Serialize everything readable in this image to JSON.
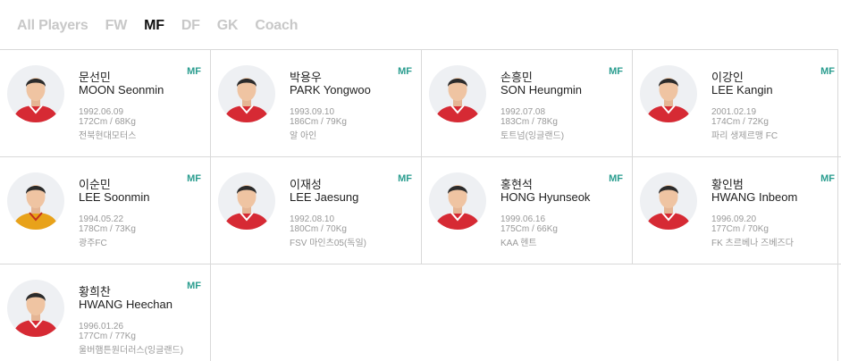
{
  "tabs": [
    "All Players",
    "FW",
    "MF",
    "DF",
    "GK",
    "Coach"
  ],
  "active_tab": "MF",
  "colors": {
    "position_badge": "#2a9d8f",
    "jersey": "#d62a34",
    "active_tab": "#111111",
    "inactive_tab": "#c8c8c8"
  },
  "players": [
    {
      "position": "MF",
      "korean_name": "문선민",
      "english_name": "MOON Seonmin",
      "birth_date": "1992.06.09",
      "height_weight": "172Cm / 68Kg",
      "club": "전북현대모터스",
      "jersey": "red"
    },
    {
      "position": "MF",
      "korean_name": "박용우",
      "english_name": "PARK Yongwoo",
      "birth_date": "1993.09.10",
      "height_weight": "186Cm / 79Kg",
      "club": "알 아인",
      "jersey": "red"
    },
    {
      "position": "MF",
      "korean_name": "손흥민",
      "english_name": "SON Heungmin",
      "birth_date": "1992.07.08",
      "height_weight": "183Cm / 78Kg",
      "club": "토트넘(잉글랜드)",
      "jersey": "red"
    },
    {
      "position": "MF",
      "korean_name": "이강인",
      "english_name": "LEE Kangin",
      "birth_date": "2001.02.19",
      "height_weight": "174Cm / 72Kg",
      "club": "파리 생제르맹 FC",
      "jersey": "red"
    },
    {
      "position": "MF",
      "korean_name": "이순민",
      "english_name": "LEE Soonmin",
      "birth_date": "1994.05.22",
      "height_weight": "178Cm / 73Kg",
      "club": "광주FC",
      "jersey": "yellow"
    },
    {
      "position": "MF",
      "korean_name": "이재성",
      "english_name": "LEE Jaesung",
      "birth_date": "1992.08.10",
      "height_weight": "180Cm / 70Kg",
      "club": "FSV 마인츠05(독일)",
      "jersey": "red"
    },
    {
      "position": "MF",
      "korean_name": "홍현석",
      "english_name": "HONG Hyunseok",
      "birth_date": "1999.06.16",
      "height_weight": "175Cm / 66Kg",
      "club": "KAA 헨트",
      "jersey": "red"
    },
    {
      "position": "MF",
      "korean_name": "황인범",
      "english_name": "HWANG Inbeom",
      "birth_date": "1996.09.20",
      "height_weight": "177Cm / 70Kg",
      "club": "FK 츠르베나 즈베즈다",
      "jersey": "red"
    },
    {
      "position": "MF",
      "korean_name": "황희찬",
      "english_name": "HWANG Heechan",
      "birth_date": "1996.01.26",
      "height_weight": "177Cm / 77Kg",
      "club": "울버햄튼원더러스(잉글랜드)",
      "jersey": "red"
    }
  ]
}
